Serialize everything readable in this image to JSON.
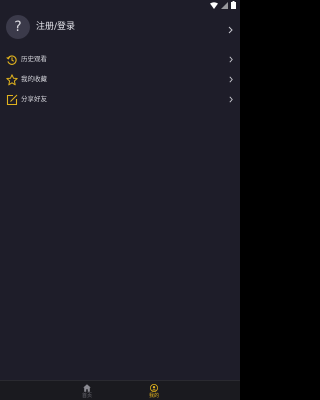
{
  "profile": {
    "avatar_glyph": "?",
    "login_label": "注册/登录",
    "avatar_icon": "question-mark-icon"
  },
  "menu": [
    {
      "label": "历史观看",
      "icon": "history-icon"
    },
    {
      "label": "我的收藏",
      "icon": "star-icon"
    },
    {
      "label": "分享好友",
      "icon": "share-icon"
    }
  ],
  "tabbar": {
    "tabs": [
      {
        "label": "首页",
        "icon": "home-icon",
        "active": false
      },
      {
        "label": "我的",
        "icon": "user-icon",
        "active": true
      }
    ]
  },
  "colors": {
    "background": "#1e1d29",
    "accent": "#e0b21e",
    "text": "#d4d4da",
    "tab_inactive": "#6a6a72"
  }
}
